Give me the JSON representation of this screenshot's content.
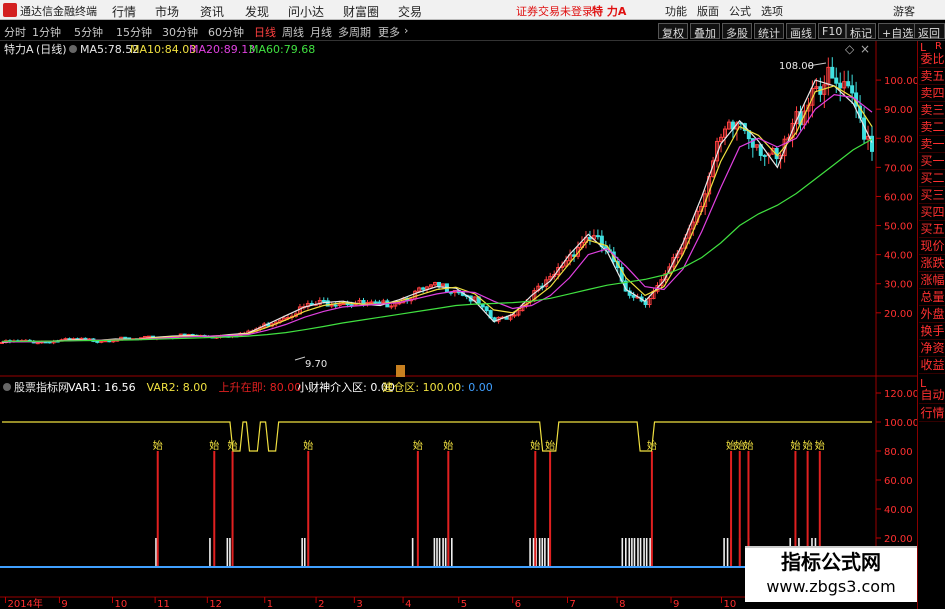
{
  "app": {
    "name": "通达信金融终端"
  },
  "menu": [
    "行情",
    "市场",
    "资讯",
    "发现",
    "问小达",
    "财富圈",
    "交易"
  ],
  "status": {
    "trade_login": "证券交易未登录",
    "stock": "特 力A"
  },
  "top_links": [
    "功能",
    "版面",
    "公式",
    "选项",
    "游客"
  ],
  "period_tabs": [
    "分时",
    "1分钟",
    "5分钟",
    "15分钟",
    "30分钟",
    "60分钟",
    "日线",
    "周线",
    "月线",
    "多周期",
    "更多"
  ],
  "active_period": "日线",
  "right_tools": [
    "复权",
    "叠加",
    "多股",
    "统计",
    "画线",
    "F10",
    "标记",
    "+自选",
    "返回"
  ],
  "main_chart": {
    "stock_label": "特力A",
    "period_label": "(日线)",
    "ma": [
      {
        "name": "MA5",
        "value": "78.52",
        "color": "#e8e8e8"
      },
      {
        "name": "MA10",
        "value": "84.03",
        "color": "#f0e040"
      },
      {
        "name": "MA20",
        "value": "89.13",
        "color": "#e040e0"
      },
      {
        "name": "MA60",
        "value": "79.68",
        "color": "#40e040"
      }
    ],
    "high_label": "108.00",
    "low_label": "9.70",
    "yticks": [
      "100.00",
      "90.00",
      "80.00",
      "70.00",
      "60.00",
      "50.00",
      "40.00",
      "30.00",
      "20.00"
    ]
  },
  "sub_chart": {
    "name": "股票指标网",
    "vars": [
      {
        "label": "VAR1:",
        "value": "16.56",
        "color": "#ffffff"
      },
      {
        "label": "VAR2:",
        "value": "8.00",
        "color": "#f0e040"
      },
      {
        "label": "上升在即:",
        "value": "80.00",
        "color": "#e02020"
      },
      {
        "label": "小财神介入区:",
        "value": "0.00",
        "color": "#ffffff"
      },
      {
        "label": "建仓区:",
        "value": "100.00",
        "color": "#f0e040"
      },
      {
        "label": ":",
        "value": "0.00",
        "color": "#40a0ff"
      }
    ],
    "yticks": [
      "120.00",
      "100.00",
      "80.00",
      "60.00",
      "40.00",
      "20.00"
    ],
    "signal_label": "始"
  },
  "xaxis": [
    "2014年",
    "9",
    "10",
    "11",
    "12",
    "1",
    "2",
    "3",
    "4",
    "5",
    "6",
    "7",
    "8",
    "9",
    "10"
  ],
  "side_panel": {
    "top": [
      "L",
      "R"
    ],
    "items": [
      "委比",
      "卖五",
      "卖四",
      "卖三",
      "卖二",
      "卖一",
      "买一",
      "买二",
      "买三",
      "买四",
      "买五",
      "现价",
      "涨跌",
      "涨幅",
      "总量",
      "外盘",
      "换手",
      "净资",
      "收益"
    ],
    "bottom_section": [
      "L"
    ],
    "bottom": [
      "自动",
      "行情"
    ]
  },
  "watermark": {
    "line1": "指标公式网",
    "line2": "www.zbgs3.com"
  },
  "chart_data": {
    "type": "line",
    "series": [
      {
        "name": "MA5",
        "values": [
          9.8,
          10.2,
          10.0,
          10.4,
          10.8,
          10.5,
          11.0,
          10.8,
          11.5,
          12.0,
          12.2,
          11.8,
          12.5,
          13.0,
          16.0,
          19.0,
          22.0,
          23.5,
          24.0,
          23.0,
          22.5,
          24.5,
          27.0,
          29.0,
          28.5,
          24.0,
          17.0,
          19.5,
          26.0,
          31.0,
          40.0,
          47.0,
          41.0,
          28.0,
          24.0,
          31.0,
          44.0,
          60.0,
          78.0,
          86.0,
          79.0,
          70.0,
          86.0,
          100.0,
          98.0,
          92.0,
          78.5
        ]
      },
      {
        "name": "MA10",
        "values": [
          9.9,
          10.1,
          10.2,
          10.3,
          10.6,
          10.6,
          10.8,
          10.9,
          11.3,
          11.8,
          12.0,
          12.0,
          12.3,
          12.8,
          15.0,
          17.5,
          20.5,
          22.5,
          23.5,
          23.0,
          23.0,
          24.0,
          26.0,
          28.0,
          28.8,
          26.5,
          21.0,
          20.0,
          24.0,
          29.0,
          37.0,
          45.0,
          43.0,
          32.0,
          26.0,
          29.0,
          40.0,
          55.0,
          72.0,
          84.0,
          81.0,
          74.0,
          82.0,
          96.0,
          98.0,
          94.0,
          84.0
        ]
      },
      {
        "name": "MA20",
        "values": [
          10.0,
          10.0,
          10.1,
          10.3,
          10.5,
          10.6,
          10.7,
          10.8,
          11.1,
          11.5,
          11.8,
          12.0,
          12.2,
          12.5,
          14.0,
          16.0,
          18.5,
          20.5,
          22.0,
          22.5,
          23.0,
          23.5,
          25.0,
          26.5,
          27.5,
          27.0,
          24.0,
          21.5,
          22.5,
          26.0,
          32.0,
          40.0,
          42.0,
          36.0,
          29.0,
          28.0,
          35.0,
          48.0,
          63.0,
          77.0,
          80.0,
          77.0,
          80.0,
          90.0,
          95.0,
          94.0,
          89.0
        ]
      },
      {
        "name": "MA60",
        "values": [
          10.2,
          10.2,
          10.2,
          10.3,
          10.4,
          10.5,
          10.6,
          10.7,
          10.9,
          11.1,
          11.3,
          11.5,
          11.7,
          12.0,
          12.5,
          13.2,
          14.2,
          15.3,
          16.5,
          17.5,
          18.5,
          19.5,
          20.5,
          21.5,
          22.5,
          23.0,
          23.2,
          23.5,
          24.0,
          25.0,
          26.5,
          28.0,
          29.5,
          30.5,
          31.5,
          33.0,
          35.5,
          39.0,
          44.0,
          50.0,
          54.0,
          57.0,
          61.0,
          66.0,
          71.0,
          76.0,
          79.7
        ]
      }
    ],
    "ylim": [
      0,
      110
    ],
    "yticks": [
      20,
      30,
      40,
      50,
      60,
      70,
      80,
      90,
      100
    ],
    "annotations": [
      {
        "text": "108.00",
        "value": 108.0
      },
      {
        "text": "9.70",
        "value": 9.7
      }
    ],
    "indicator": {
      "ylim": [
        0,
        120
      ],
      "yticks": [
        20,
        40,
        60,
        80,
        100,
        120
      ],
      "baseline_level": 100,
      "dip_level": 80,
      "dips": [
        [
          0.262,
          0.277
        ],
        [
          0.281,
          0.297
        ],
        [
          0.303,
          0.318
        ],
        [
          0.618,
          0.64
        ],
        [
          0.73,
          0.75
        ]
      ],
      "signals": [
        0.179,
        0.244,
        0.265,
        0.352,
        0.478,
        0.513,
        0.613,
        0.63,
        0.747,
        0.838,
        0.848,
        0.858,
        0.912,
        0.926,
        0.94
      ],
      "white_bars": [
        0.177,
        0.239,
        0.259,
        0.262,
        0.345,
        0.348,
        0.352,
        0.472,
        0.497,
        0.5,
        0.503,
        0.507,
        0.51,
        0.513,
        0.517,
        0.607,
        0.611,
        0.614,
        0.618,
        0.621,
        0.624,
        0.628,
        0.713,
        0.717,
        0.721,
        0.724,
        0.727,
        0.731,
        0.734,
        0.738,
        0.741,
        0.745,
        0.83,
        0.834,
        0.838,
        0.848,
        0.858,
        0.906,
        0.916,
        0.931,
        0.935
      ],
      "white_bar_level": 20
    }
  }
}
